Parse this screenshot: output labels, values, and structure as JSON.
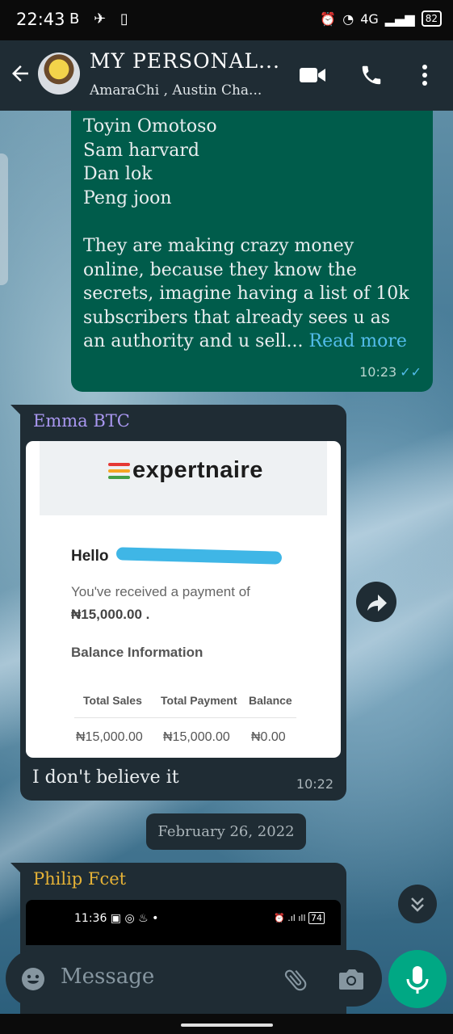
{
  "status_bar": {
    "time": "22:43",
    "left_icons": "B ✈ ▯",
    "network": "4G",
    "battery": "82"
  },
  "header": {
    "title": "MY PERSONAL...",
    "subtitle": "AmaraChi , Austin Cha..."
  },
  "messages": {
    "outgoing": {
      "lines": [
        "Toyin Omotoso",
        "Sam harvard",
        "Dan lok",
        "Peng joon",
        "",
        "They are making crazy money",
        "online, because they know the",
        "secrets, imagine having a list of 10k",
        "subscribers that already sees u as"
      ],
      "last_line": "an authority and u sell...",
      "read_more": "Read more",
      "time": "10:23"
    },
    "incoming": {
      "sender": "Emma BTC",
      "email": {
        "logo": "expertnaire",
        "greeting": "Hello",
        "received_text": "You've received a payment of",
        "amount": "₦15,000.00 .",
        "balance_title": "Balance Information",
        "table_headers": [
          "Total Sales",
          "Total Payment",
          "Balance"
        ],
        "table_values": [
          "₦15,000.00",
          "₦15,000.00",
          "₦0.00"
        ]
      },
      "caption": "I don't believe it",
      "time": "10:22"
    },
    "date_chip": "February 26, 2022",
    "incoming2": {
      "sender": "Philip Fcet",
      "nested_time": "11:36",
      "nested_battery": "74"
    }
  },
  "composer": {
    "placeholder": "Message"
  },
  "colors": {
    "accent": "#00a884",
    "outgoing_bubble": "#005c4b",
    "incoming_bubble": "#1f2c34",
    "link": "#53bdeb"
  }
}
